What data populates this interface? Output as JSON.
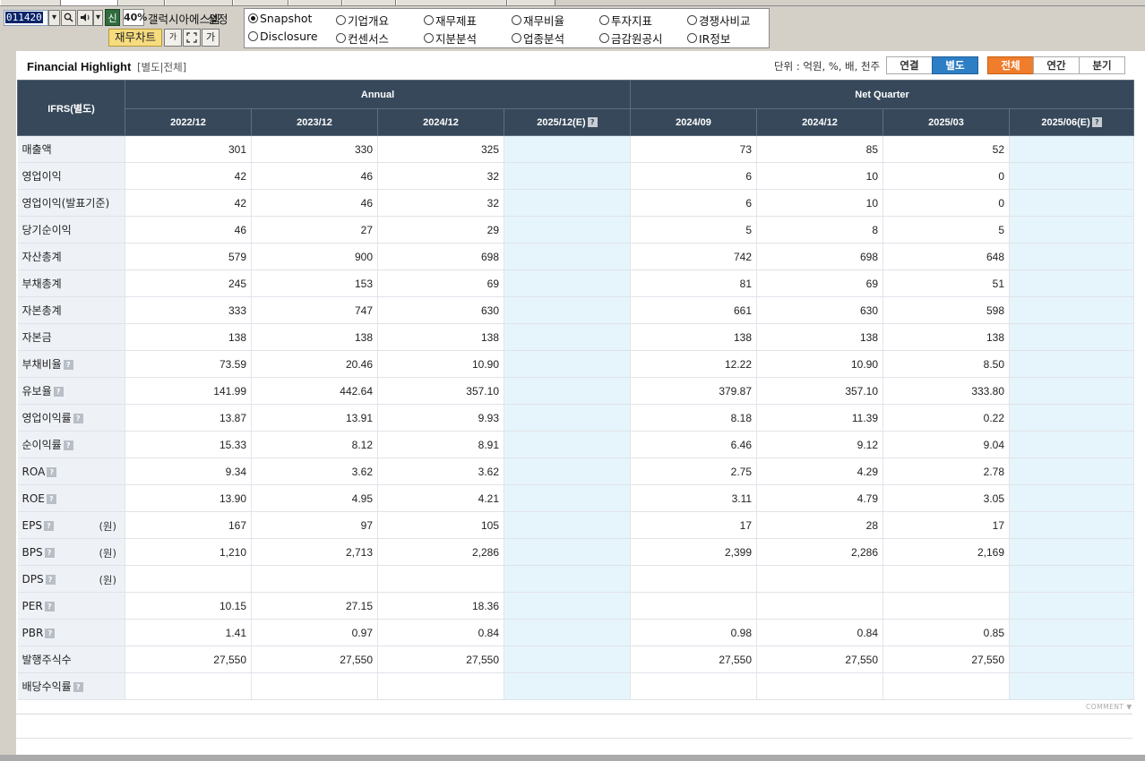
{
  "toolbar": {
    "stock_code": "011420",
    "rate_badge": "신",
    "percent": "40%",
    "company_name": "갤럭시아에스엠",
    "settings_label": "설정",
    "fin_chart_label": "재무차트",
    "btn_small_a": "가",
    "btn_small_b": "가"
  },
  "radio_options": [
    {
      "label": "Snapshot",
      "checked": true
    },
    {
      "label": "기업개요",
      "checked": false
    },
    {
      "label": "재무제표",
      "checked": false
    },
    {
      "label": "재무비율",
      "checked": false
    },
    {
      "label": "투자지표",
      "checked": false
    },
    {
      "label": "경쟁사비교",
      "checked": false
    },
    {
      "label": "Disclosure",
      "checked": false
    },
    {
      "label": "컨센서스",
      "checked": false
    },
    {
      "label": "지분분석",
      "checked": false
    },
    {
      "label": "업종분석",
      "checked": false
    },
    {
      "label": "금감원공시",
      "checked": false
    },
    {
      "label": "IR정보",
      "checked": false
    }
  ],
  "section": {
    "title": "Financial Highlight",
    "subtitle": "[별도|전체]",
    "unit_text": "단위 : 억원, %, 배, 천주",
    "toggle_consolidated": "연결",
    "toggle_separate": "별도",
    "toggle_all": "전체",
    "toggle_annual": "연간",
    "toggle_quarter": "분기"
  },
  "table": {
    "corner": "IFRS(별도)",
    "group_annual": "Annual",
    "group_quarter": "Net Quarter",
    "columns": [
      "2022/12",
      "2023/12",
      "2024/12",
      "2025/12(E)",
      "2024/09",
      "2024/12",
      "2025/03",
      "2025/06(E)"
    ],
    "estimate_badge": "?",
    "help_badge": "?",
    "rows": [
      {
        "label": "매출액",
        "help": false,
        "unit": "",
        "values": [
          "301",
          "330",
          "325",
          "",
          "73",
          "85",
          "52",
          ""
        ]
      },
      {
        "label": "영업이익",
        "help": false,
        "unit": "",
        "values": [
          "42",
          "46",
          "32",
          "",
          "6",
          "10",
          "0",
          ""
        ]
      },
      {
        "label": "영업이익(발표기준)",
        "help": false,
        "unit": "",
        "values": [
          "42",
          "46",
          "32",
          "",
          "6",
          "10",
          "0",
          ""
        ]
      },
      {
        "label": "당기순이익",
        "help": false,
        "unit": "",
        "values": [
          "46",
          "27",
          "29",
          "",
          "5",
          "8",
          "5",
          ""
        ]
      },
      {
        "label": "자산총계",
        "help": false,
        "unit": "",
        "values": [
          "579",
          "900",
          "698",
          "",
          "742",
          "698",
          "648",
          ""
        ]
      },
      {
        "label": "부채총계",
        "help": false,
        "unit": "",
        "values": [
          "245",
          "153",
          "69",
          "",
          "81",
          "69",
          "51",
          ""
        ]
      },
      {
        "label": "자본총계",
        "help": false,
        "unit": "",
        "values": [
          "333",
          "747",
          "630",
          "",
          "661",
          "630",
          "598",
          ""
        ]
      },
      {
        "label": "자본금",
        "help": false,
        "unit": "",
        "values": [
          "138",
          "138",
          "138",
          "",
          "138",
          "138",
          "138",
          ""
        ]
      },
      {
        "label": "부채비율",
        "help": true,
        "unit": "",
        "values": [
          "73.59",
          "20.46",
          "10.90",
          "",
          "12.22",
          "10.90",
          "8.50",
          ""
        ]
      },
      {
        "label": "유보율",
        "help": true,
        "unit": "",
        "values": [
          "141.99",
          "442.64",
          "357.10",
          "",
          "379.87",
          "357.10",
          "333.80",
          ""
        ]
      },
      {
        "label": "영업이익률",
        "help": true,
        "unit": "",
        "values": [
          "13.87",
          "13.91",
          "9.93",
          "",
          "8.18",
          "11.39",
          "0.22",
          ""
        ]
      },
      {
        "label": "순이익률",
        "help": true,
        "unit": "",
        "values": [
          "15.33",
          "8.12",
          "8.91",
          "",
          "6.46",
          "9.12",
          "9.04",
          ""
        ]
      },
      {
        "label": "ROA",
        "help": true,
        "unit": "",
        "values": [
          "9.34",
          "3.62",
          "3.62",
          "",
          "2.75",
          "4.29",
          "2.78",
          ""
        ]
      },
      {
        "label": "ROE",
        "help": true,
        "unit": "",
        "values": [
          "13.90",
          "4.95",
          "4.21",
          "",
          "3.11",
          "4.79",
          "3.05",
          ""
        ]
      },
      {
        "label": "EPS",
        "help": true,
        "unit": "(원)",
        "values": [
          "167",
          "97",
          "105",
          "",
          "17",
          "28",
          "17",
          ""
        ]
      },
      {
        "label": "BPS",
        "help": true,
        "unit": "(원)",
        "values": [
          "1,210",
          "2,713",
          "2,286",
          "",
          "2,399",
          "2,286",
          "2,169",
          ""
        ]
      },
      {
        "label": "DPS",
        "help": true,
        "unit": "(원)",
        "values": [
          "",
          "",
          "",
          "",
          "",
          "",
          "",
          ""
        ]
      },
      {
        "label": "PER",
        "help": true,
        "unit": "",
        "values": [
          "10.15",
          "27.15",
          "18.36",
          "",
          "",
          "",
          "",
          ""
        ]
      },
      {
        "label": "PBR",
        "help": true,
        "unit": "",
        "values": [
          "1.41",
          "0.97",
          "0.84",
          "",
          "0.98",
          "0.84",
          "0.85",
          ""
        ]
      },
      {
        "label": "발행주식수",
        "help": false,
        "unit": "",
        "values": [
          "27,550",
          "27,550",
          "27,550",
          "",
          "27,550",
          "27,550",
          "27,550",
          ""
        ]
      },
      {
        "label": "배당수익률",
        "help": true,
        "unit": "",
        "values": [
          "",
          "",
          "",
          "",
          "",
          "",
          "",
          ""
        ]
      }
    ]
  },
  "footer": {
    "comment_label": "COMMENT"
  }
}
